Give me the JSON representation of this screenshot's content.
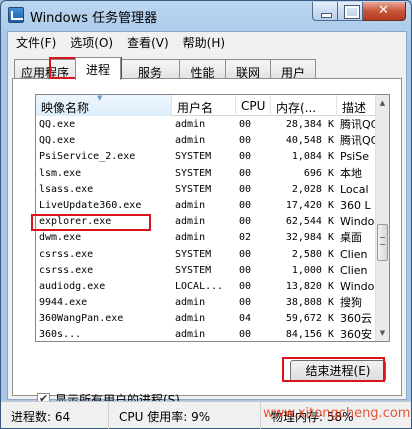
{
  "window": {
    "title": "Windows 任务管理器"
  },
  "menu": [
    "文件(F)",
    "选项(O)",
    "查看(V)",
    "帮助(H)"
  ],
  "tabs": [
    "应用程序",
    "进程",
    "服务",
    "性能",
    "联网",
    "用户"
  ],
  "active_tab_index": 1,
  "columns": [
    "映像名称",
    "用户名",
    "CPU",
    "内存(...",
    "描述"
  ],
  "rows": [
    {
      "name": "QQ.exe",
      "user": "admin",
      "cpu": "00",
      "mem": "28,384 K",
      "desc": "腾讯QQ"
    },
    {
      "name": "QQ.exe",
      "user": "admin",
      "cpu": "00",
      "mem": "40,548 K",
      "desc": "腾讯QQ"
    },
    {
      "name": "PsiService_2.exe",
      "user": "SYSTEM",
      "cpu": "00",
      "mem": "1,084 K",
      "desc": "PsiSe"
    },
    {
      "name": "lsm.exe",
      "user": "SYSTEM",
      "cpu": "00",
      "mem": "696 K",
      "desc": "本地"
    },
    {
      "name": "lsass.exe",
      "user": "SYSTEM",
      "cpu": "00",
      "mem": "2,028 K",
      "desc": "Local"
    },
    {
      "name": "LiveUpdate360.exe",
      "user": "admin",
      "cpu": "00",
      "mem": "17,420 K",
      "desc": "360 L"
    },
    {
      "name": "explorer.exe",
      "user": "admin",
      "cpu": "00",
      "mem": "62,544 K",
      "desc": "Windo"
    },
    {
      "name": "dwm.exe",
      "user": "admin",
      "cpu": "02",
      "mem": "32,984 K",
      "desc": "桌面"
    },
    {
      "name": "csrss.exe",
      "user": "SYSTEM",
      "cpu": "00",
      "mem": "2,580 K",
      "desc": "Clien"
    },
    {
      "name": "csrss.exe",
      "user": "SYSTEM",
      "cpu": "00",
      "mem": "1,000 K",
      "desc": "Clien"
    },
    {
      "name": "audiodg.exe",
      "user": "LOCAL...",
      "cpu": "00",
      "mem": "13,820 K",
      "desc": "Windo"
    },
    {
      "name": "9944.exe",
      "user": "admin",
      "cpu": "00",
      "mem": "38,808 K",
      "desc": "搜狗"
    },
    {
      "name": "360WangPan.exe",
      "user": "admin",
      "cpu": "04",
      "mem": "59,672 K",
      "desc": "360云"
    },
    {
      "name": "360s...",
      "user": "admin",
      "cpu": "00",
      "mem": "84,156 K",
      "desc": "360安"
    }
  ],
  "scroll": {
    "thumb_start": 0.53,
    "thumb_size": 0.17
  },
  "show_all_users": {
    "label": "显示所有用户的进程(S)",
    "checked": true
  },
  "end_process_label": "结束进程(E)",
  "status": {
    "processes": "进程数: 64",
    "cpu": "CPU 使用率: 9%",
    "memory": "物理内存: 58%"
  },
  "watermark": "www.xitongcheng.com",
  "highlight_color": "#d9141c"
}
